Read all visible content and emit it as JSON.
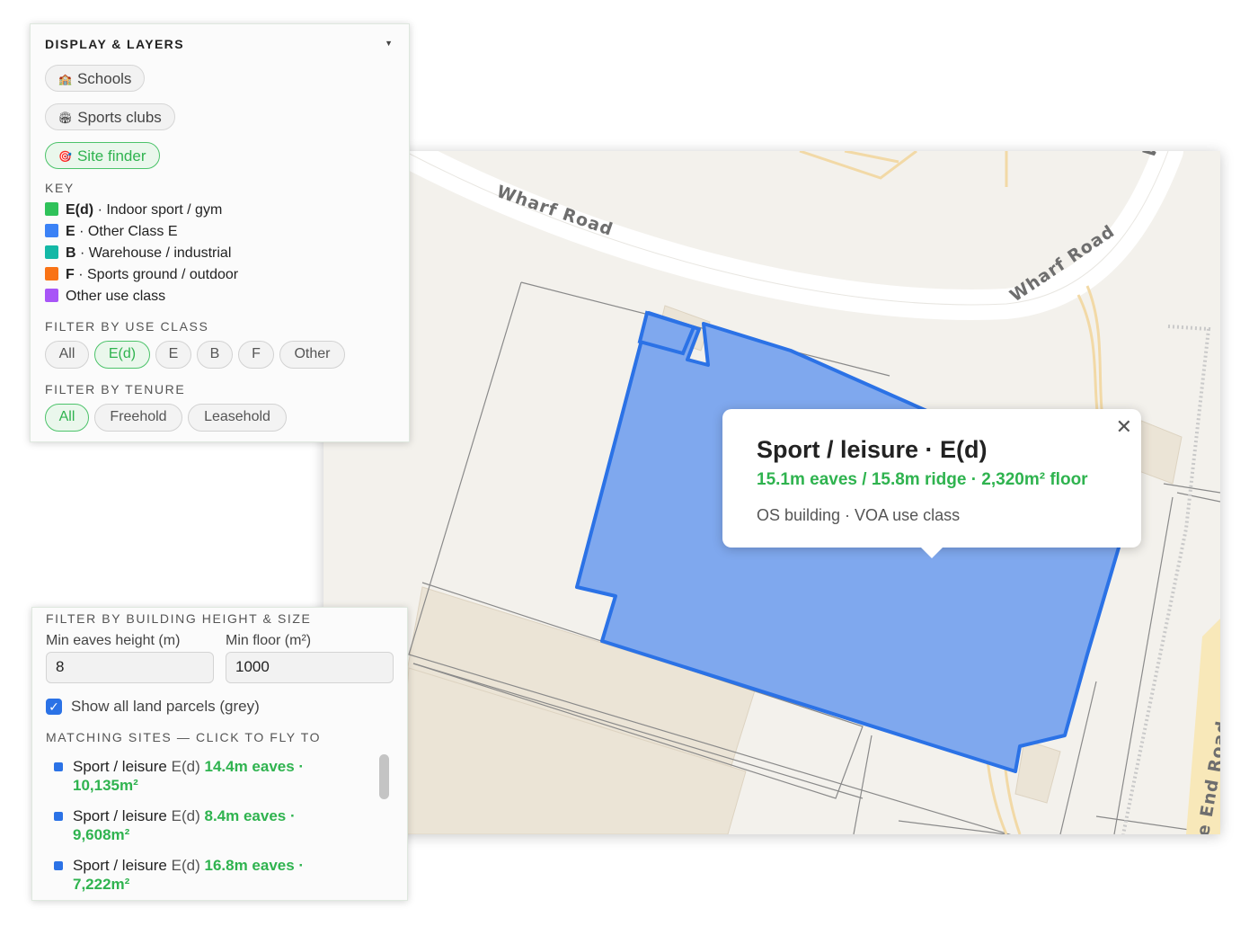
{
  "layers_panel": {
    "title": "DISPLAY & LAYERS",
    "collapse_icon": "caret-down-icon",
    "layers": [
      {
        "label": "Schools",
        "icon": "school-icon",
        "active": false
      },
      {
        "label": "Sports clubs",
        "icon": "stadium-icon",
        "active": false
      },
      {
        "label": "Site finder",
        "icon": "target-icon",
        "active": true
      }
    ],
    "key_label": "KEY",
    "key": [
      {
        "code": "E(d)",
        "desc": "· Indoor sport / gym",
        "color": "#2fc25a"
      },
      {
        "code": "E",
        "desc": "· Other Class E",
        "color": "#3b82f6"
      },
      {
        "code": "B",
        "desc": "· Warehouse / industrial",
        "color": "#14b8a6"
      },
      {
        "code": "F",
        "desc": "· Sports ground / outdoor",
        "color": "#f97316"
      },
      {
        "code": "",
        "desc": "Other use class",
        "color": "#a855f7"
      }
    ],
    "use_class_label": "FILTER BY USE CLASS",
    "use_class_filters": [
      {
        "label": "All",
        "active": false
      },
      {
        "label": "E(d)",
        "active": true
      },
      {
        "label": "E",
        "active": false
      },
      {
        "label": "B",
        "active": false
      },
      {
        "label": "F",
        "active": false
      },
      {
        "label": "Other",
        "active": false
      }
    ],
    "tenure_label": "FILTER BY TENURE",
    "tenure_filters": [
      {
        "label": "All",
        "active": true
      },
      {
        "label": "Freehold",
        "active": false
      },
      {
        "label": "Leasehold",
        "active": false
      }
    ]
  },
  "size_panel": {
    "title": "FILTER BY BUILDING HEIGHT & SIZE",
    "eaves_label": "Min eaves height (m)",
    "eaves_value": "8",
    "floor_label": "Min floor (m²)",
    "floor_value": "1000",
    "parcels_label": "Show all land parcels (grey)",
    "parcels_checked": true,
    "matching_label": "MATCHING SITES — CLICK TO FLY TO",
    "sites": [
      {
        "name": "Sport / leisure",
        "class": "E(d)",
        "eaves": "14.4m eaves ·",
        "floor": "10,135m²"
      },
      {
        "name": "Sport / leisure",
        "class": "E(d)",
        "eaves": "8.4m eaves ·",
        "floor": "9,608m²"
      },
      {
        "name": "Sport / leisure",
        "class": "E(d)",
        "eaves": "16.8m eaves ·",
        "floor": "7,222m²"
      }
    ]
  },
  "map": {
    "road_labels": [
      "Wharf Road",
      "Wharf Road",
      "W",
      "e End Road"
    ],
    "highlight_color": "#2b72e6",
    "popup": {
      "title": "Sport / leisure · E(d)",
      "stats": "15.1m eaves / 15.8m ridge · 2,320m² floor",
      "source": "OS building · VOA use class",
      "close_icon": "close-icon"
    }
  }
}
